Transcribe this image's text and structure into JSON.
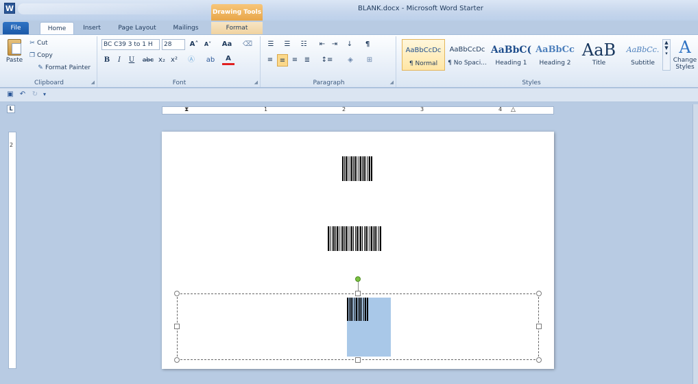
{
  "window": {
    "app_icon": "W",
    "title": "BLANK.docx - Microsoft Word Starter",
    "contextual_group": "Drawing Tools"
  },
  "tabs": [
    {
      "label": "File"
    },
    {
      "label": "Home"
    },
    {
      "label": "Insert"
    },
    {
      "label": "Page Layout"
    },
    {
      "label": "Mailings"
    },
    {
      "label": "Format"
    }
  ],
  "ribbon": {
    "clipboard": {
      "label": "Clipboard",
      "paste": "Paste",
      "cut": "Cut",
      "copy": "Copy",
      "format_painter": "Format Painter"
    },
    "font": {
      "label": "Font",
      "font_name": "BC C39 3 to 1 H",
      "font_size": "28",
      "bold": "B",
      "italic": "I",
      "underline": "U",
      "strikethrough": "abc",
      "subscript": "x₂",
      "superscript": "x²",
      "grow": "A˄",
      "shrink": "A˅",
      "change_case": "Aa",
      "text_color": "A"
    },
    "paragraph": {
      "label": "Paragraph",
      "pilcrow": "¶"
    },
    "styles": {
      "label": "Styles",
      "items": [
        {
          "sample": "AaBbCcDc",
          "name": "¶ Normal"
        },
        {
          "sample": "AaBbCcDc",
          "name": "¶ No Spaci..."
        },
        {
          "sample": "AaBbC(",
          "name": "Heading 1"
        },
        {
          "sample": "AaBbCc",
          "name": "Heading 2"
        },
        {
          "sample": "AaB",
          "name": "Title"
        },
        {
          "sample": "AaBbCc.",
          "name": "Subtitle"
        }
      ],
      "change_styles": "Change Styles",
      "change_styles_icon": "A"
    }
  },
  "ruler": {
    "corner": "L",
    "h_numbers": [
      "1",
      "2",
      "3",
      "4"
    ],
    "v_number": "2"
  },
  "colors": {
    "accent": "#2b5797",
    "selection_fill": "#a9c8e8",
    "rotate_handle": "#7bc142"
  }
}
